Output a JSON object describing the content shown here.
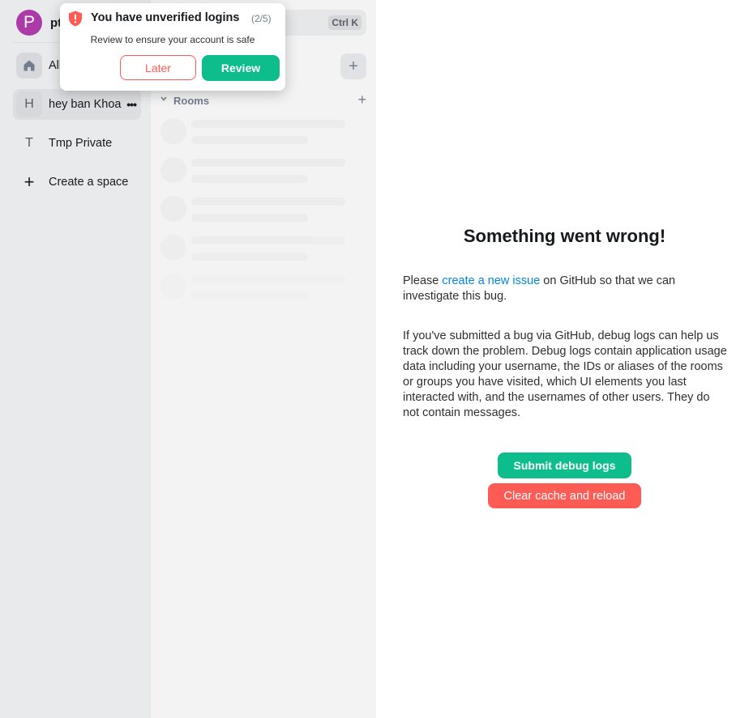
{
  "user": {
    "avatar_initial": "P",
    "name": "pt"
  },
  "spaces": {
    "home_label": "All rooms",
    "items": [
      {
        "initial": "H",
        "label": "hey ban Khoa",
        "more": "•••"
      },
      {
        "initial": "T",
        "label": "Tmp Private"
      }
    ],
    "create_icon": "+",
    "create_label": "Create a space"
  },
  "room_list": {
    "search_shortcut": "Ctrl K",
    "add_icon": "+",
    "rooms_section_title": "Rooms",
    "rooms_add_icon": "+",
    "rooms_chevron": "⌄"
  },
  "error": {
    "title": "Something went wrong!",
    "para1_prefix": "Please ",
    "para1_link": "create a new issue",
    "para1_suffix": " on GitHub so that we can investigate this bug.",
    "para2": "If you've submitted a bug via GitHub, debug logs can help us track down the problem. Debug logs contain application usage data including your username, the IDs or aliases of the rooms or groups you have visited, which UI elements you last interacted with, and the usernames of other users. They do not contain messages.",
    "submit_button": "Submit debug logs",
    "clear_button": "Clear cache and reload"
  },
  "toast": {
    "title": "You have unverified logins",
    "count": "(2/5)",
    "description": "Review to ensure your account is safe",
    "later_button": "Later",
    "review_button": "Review"
  },
  "colors": {
    "accent": "#0dbd8b",
    "alert": "#ff5b55",
    "link": "#0086e6",
    "avatar": "#ac3ba8"
  }
}
